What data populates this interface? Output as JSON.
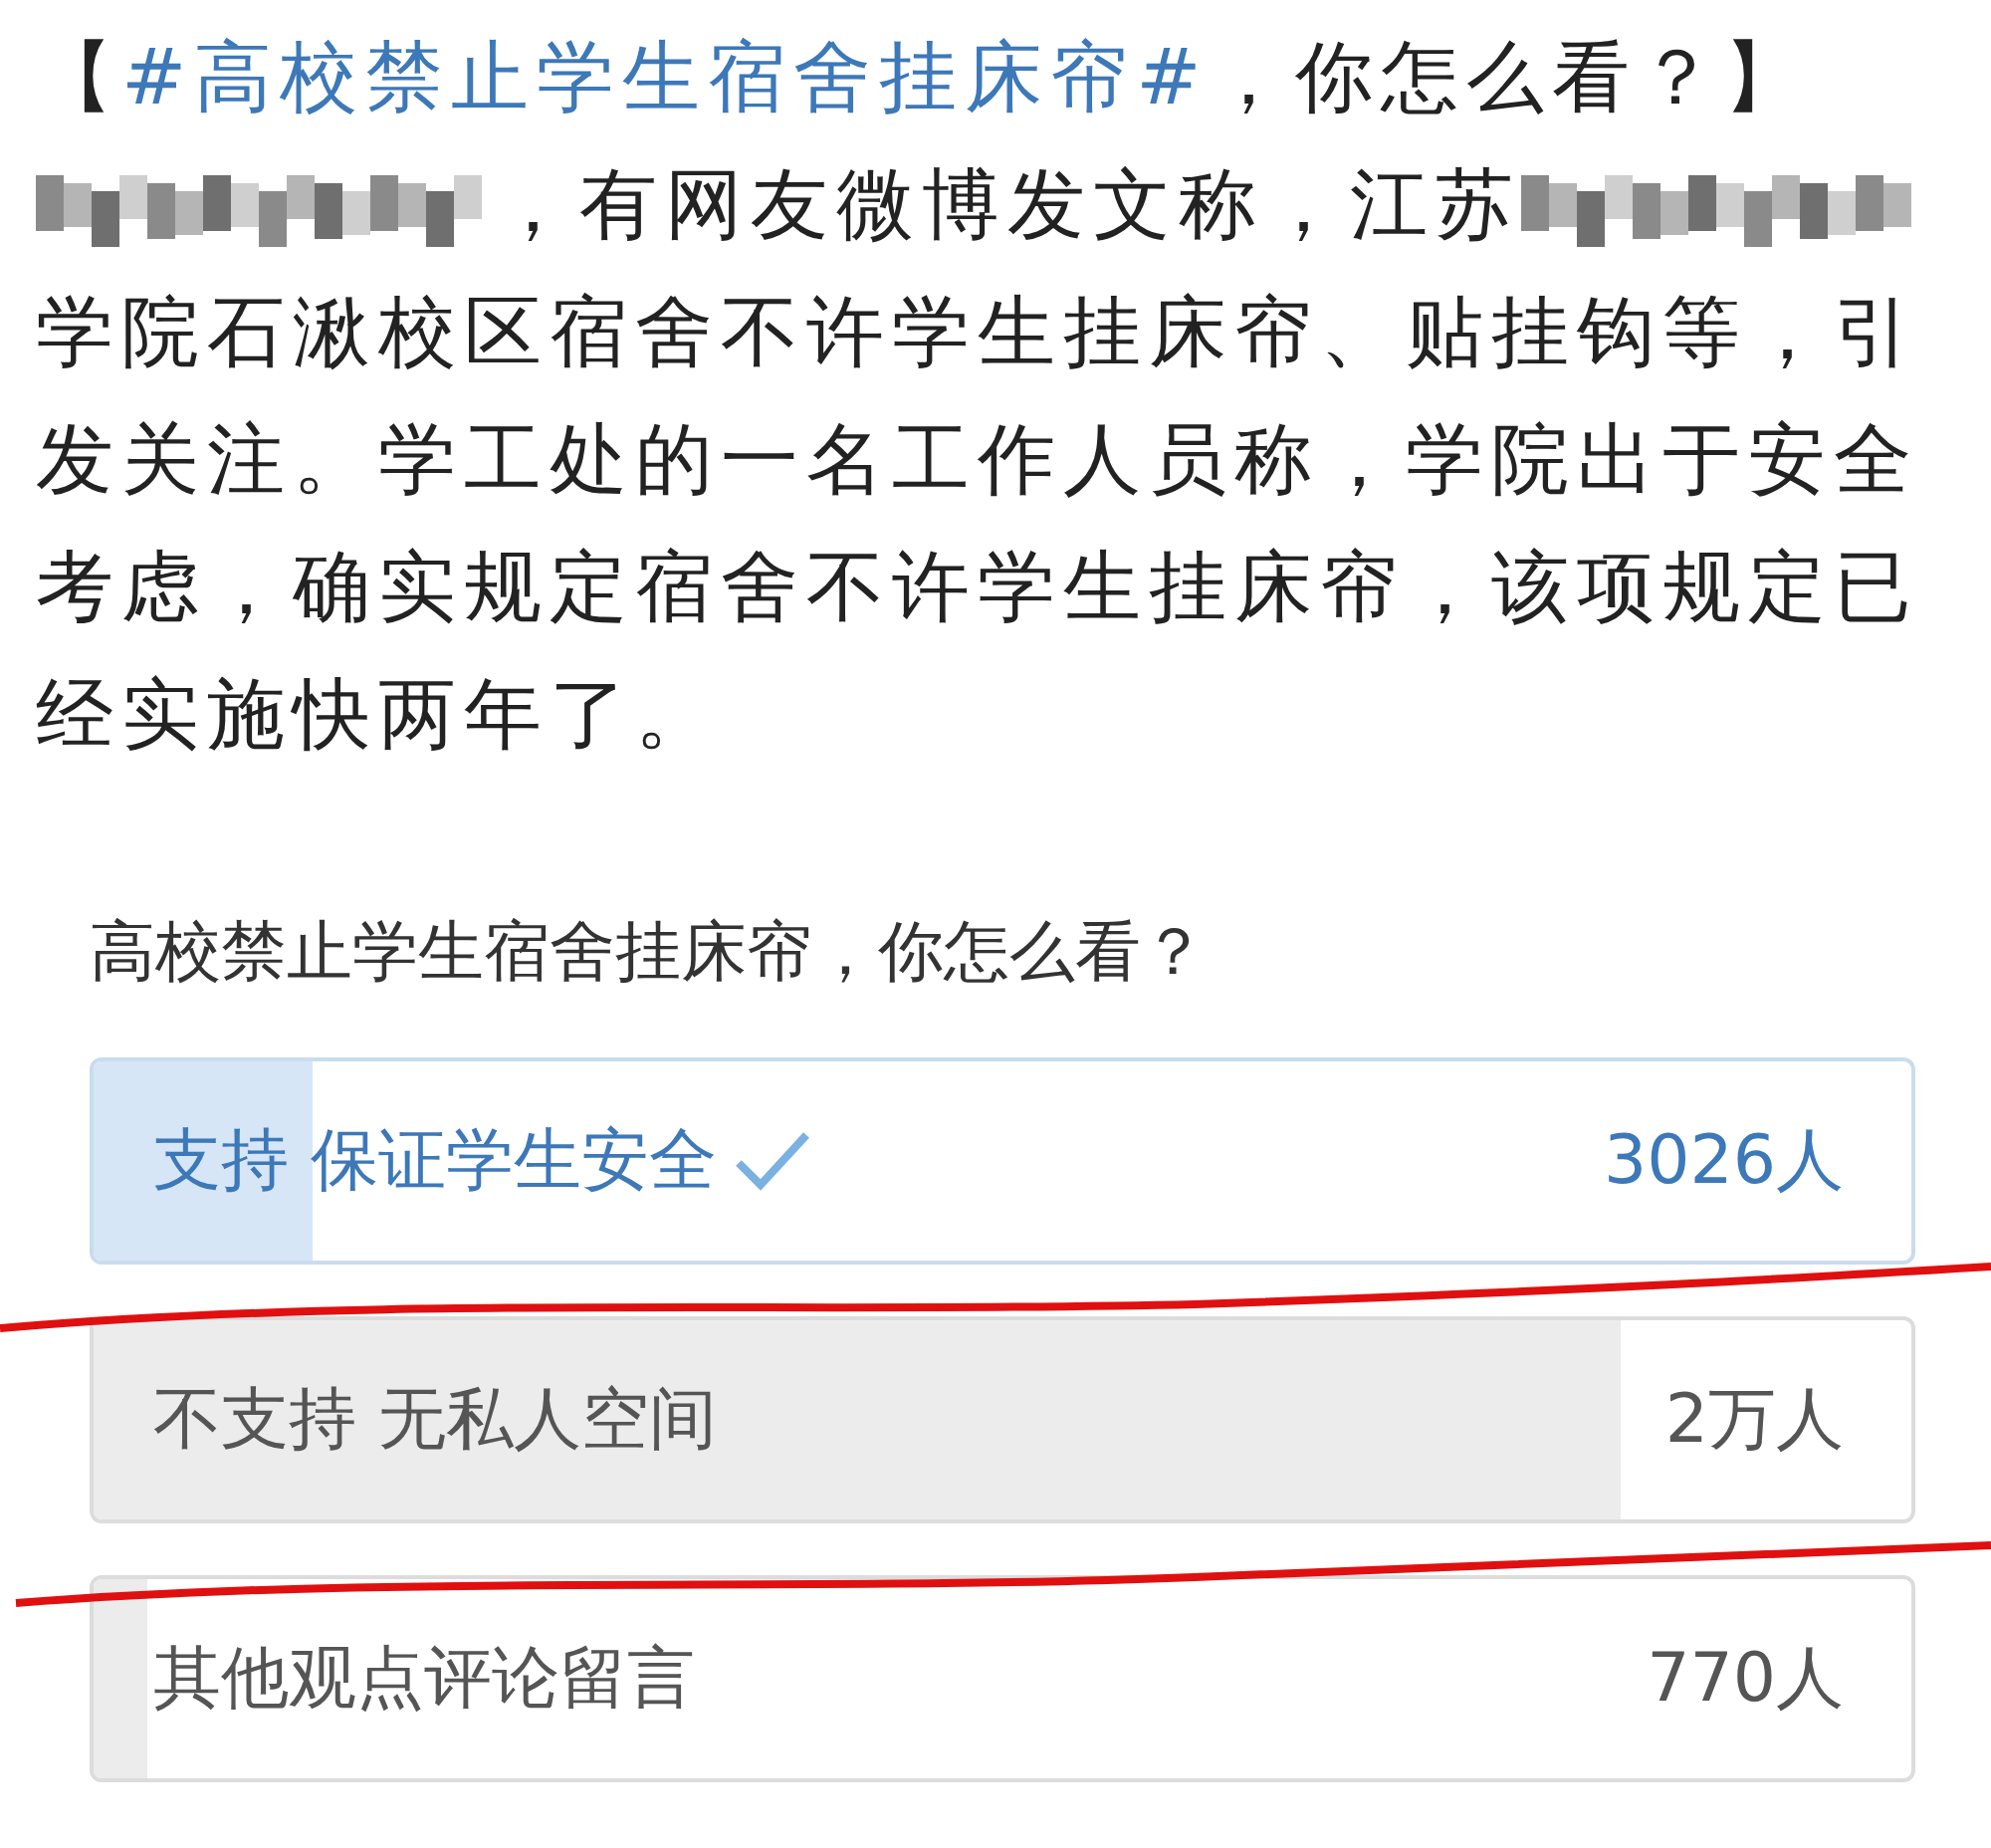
{
  "post": {
    "headline": {
      "prefix": "【",
      "hashtag": "#高校禁止学生宿舍挂床帘#",
      "suffix": "，你怎么看？】"
    },
    "lead": "，有网友微博发文称，江苏",
    "body": "学院石湫校区宿舍不许学生挂床帘、贴挂钩等，引发关注。学工处的一名工作人员称，学院出于安全考虑，确实规定宿舍不许学生挂床帘，该项规定已经实施快两年了。"
  },
  "poll": {
    "question": "高校禁止学生宿舍挂床帘，你怎么看？",
    "options": [
      {
        "label": "支持 保证学生安全",
        "count": "3026人",
        "selected": true,
        "level": 0.12
      },
      {
        "label": "不支持 无私人空间",
        "count": "2万人",
        "selected": false,
        "level": 0.84
      },
      {
        "label": "其他观点评论留言",
        "count": "770人",
        "selected": false,
        "level": 0.03
      }
    ]
  }
}
